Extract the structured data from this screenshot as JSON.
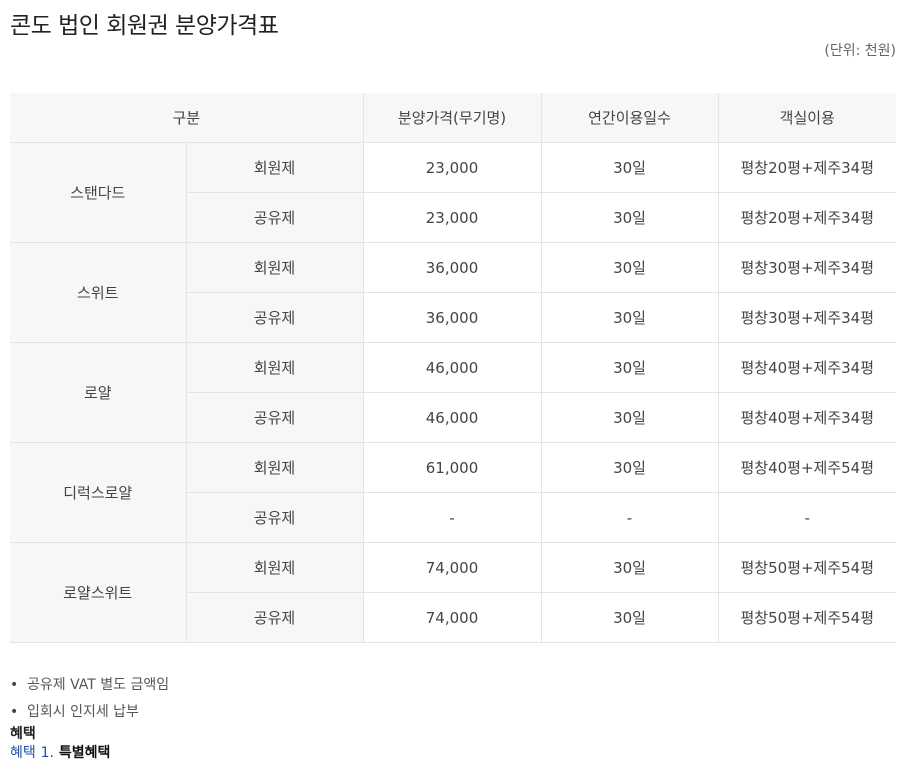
{
  "page_title": "콘도 법인 회원권 분양가격표",
  "unit_note": "(단위: 천원)",
  "table": {
    "headers": {
      "category": "구분",
      "price": "분양가격(무기명)",
      "days": "연간이용일수",
      "rooms": "객실이용"
    },
    "groups": [
      {
        "name": "스탠다드",
        "rows": [
          {
            "type": "회원제",
            "price": "23,000",
            "days": "30일",
            "rooms": "평창20평+제주34평"
          },
          {
            "type": "공유제",
            "price": "23,000",
            "days": "30일",
            "rooms": "평창20평+제주34평"
          }
        ]
      },
      {
        "name": "스위트",
        "rows": [
          {
            "type": "회원제",
            "price": "36,000",
            "days": "30일",
            "rooms": "평창30평+제주34평"
          },
          {
            "type": "공유제",
            "price": "36,000",
            "days": "30일",
            "rooms": "평창30평+제주34평"
          }
        ]
      },
      {
        "name": "로얄",
        "rows": [
          {
            "type": "회원제",
            "price": "46,000",
            "days": "30일",
            "rooms": "평창40평+제주34평"
          },
          {
            "type": "공유제",
            "price": "46,000",
            "days": "30일",
            "rooms": "평창40평+제주34평"
          }
        ]
      },
      {
        "name": "디럭스로얄",
        "rows": [
          {
            "type": "회원제",
            "price": "61,000",
            "days": "30일",
            "rooms": "평창40평+제주54평"
          },
          {
            "type": "공유제",
            "price": "-",
            "days": "-",
            "rooms": "-"
          }
        ]
      },
      {
        "name": "로얄스위트",
        "rows": [
          {
            "type": "회원제",
            "price": "74,000",
            "days": "30일",
            "rooms": "평창50평+제주54평"
          },
          {
            "type": "공유제",
            "price": "74,000",
            "days": "30일",
            "rooms": "평창50평+제주54평"
          }
        ]
      }
    ]
  },
  "notes": [
    "공유제 VAT 별도 금액임",
    "입회시 인지세 납부"
  ],
  "benefit": {
    "heading": "혜택",
    "line_prefix": "혜택",
    "line_number": "1.",
    "line_text": "특별혜택"
  }
}
